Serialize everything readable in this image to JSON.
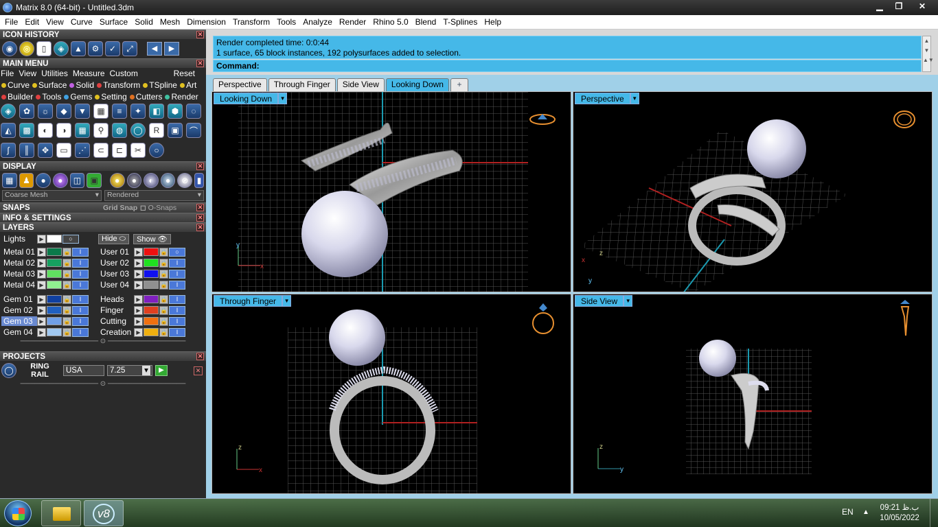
{
  "window": {
    "title": "Matrix 8.0 (64-bit) - Untitled.3dm",
    "minimize": "▁",
    "restore": "❐",
    "close": "✕"
  },
  "menubar": [
    "File",
    "Edit",
    "View",
    "Curve",
    "Surface",
    "Solid",
    "Mesh",
    "Dimension",
    "Transform",
    "Tools",
    "Analyze",
    "Render",
    "Rhino 5.0",
    "Blend",
    "T-Splines",
    "Help"
  ],
  "panels": {
    "icon_history": "ICON HISTORY",
    "main_menu": "MAIN MENU",
    "display": "DISPLAY",
    "snaps": "SNAPS",
    "grid_snap": "Grid Snap",
    "o_snaps": "O-Snaps",
    "info_settings": "INFO & SETTINGS",
    "layers": "LAYERS",
    "projects": "PROJECTS"
  },
  "main_menu": {
    "items": [
      "File",
      "View",
      "Utilities",
      "Measure",
      "Custom"
    ],
    "reset": "Reset",
    "categories": [
      {
        "label": "Curve",
        "color": "#e0c020"
      },
      {
        "label": "Surface",
        "color": "#e0c020"
      },
      {
        "label": "Solid",
        "color": "#c060e0"
      },
      {
        "label": "Transform",
        "color": "#e04040"
      },
      {
        "label": "TSpline",
        "color": "#e0c020"
      },
      {
        "label": "Art",
        "color": "#e0c020"
      }
    ],
    "categories2": [
      {
        "label": "Builder",
        "color": "#e04040"
      },
      {
        "label": "Tools",
        "color": "#e04040"
      },
      {
        "label": "Gems",
        "color": "#40a0e0"
      },
      {
        "label": "Setting",
        "color": "#e0c020"
      },
      {
        "label": "Cutters",
        "color": "#e07020"
      },
      {
        "label": "Render",
        "color": "#40c0a0"
      }
    ]
  },
  "display": {
    "mesh": "Coarse Mesh",
    "mode": "Rendered"
  },
  "layers": {
    "lights": "Lights",
    "hide": "Hide",
    "show": "Show",
    "left": [
      {
        "name": "Metal 01",
        "color": "#0a7a4a"
      },
      {
        "name": "Metal 02",
        "color": "#16a060"
      },
      {
        "name": "Metal 03",
        "color": "#60e060"
      },
      {
        "name": "Metal 04",
        "color": "#90f090"
      }
    ],
    "right": [
      {
        "name": "User 01",
        "color": "#ee1010"
      },
      {
        "name": "User 02",
        "color": "#20e020"
      },
      {
        "name": "User 03",
        "color": "#1010ee"
      },
      {
        "name": "User 04",
        "color": "#909090"
      }
    ],
    "left2": [
      {
        "name": "Gem 01",
        "color": "#1040a0"
      },
      {
        "name": "Gem 02",
        "color": "#2060c0"
      },
      {
        "name": "Gem 03",
        "color": "#70a0e8"
      },
      {
        "name": "Gem 04",
        "color": "#a0c8f0"
      }
    ],
    "right2": [
      {
        "name": "Heads",
        "color": "#8020c0"
      },
      {
        "name": "Finger",
        "color": "#e04020"
      },
      {
        "name": "Cutting",
        "color": "#f07010"
      },
      {
        "name": "Creation",
        "color": "#f0b010"
      }
    ]
  },
  "projects": {
    "label1": "RING",
    "label2": "RAIL",
    "region": "USA",
    "size": "7.25"
  },
  "command": {
    "line1": "Render completed time: 0:0:44",
    "line2": "1 surface, 65 block instances, 192 polysurfaces added to selection.",
    "prompt": "Command:"
  },
  "tabs": [
    "Perspective",
    "Through Finger",
    "Side View",
    "Looking Down"
  ],
  "tab_add": "+",
  "viewports": {
    "tl": "Looking Down",
    "tr": "Perspective",
    "bl": "Through Finger",
    "br": "Side View"
  },
  "taskbar": {
    "lang": "EN",
    "time": "09:21 ب.ظ",
    "date": "10/05/2022",
    "v8": "v8"
  }
}
